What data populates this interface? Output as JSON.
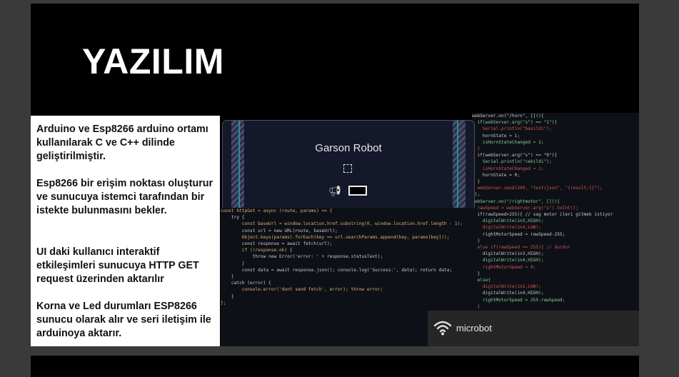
{
  "slide": {
    "title": "YAZILIM",
    "paragraphs": [
      "Arduino ve Esp8266 arduino ortamı kullanılarak C ve C++ dilinde geliştirilmiştir.",
      "Esp8266 bir erişim noktası oluşturur ve sunucuya istemci tarafından bir istekte bulunmasını bekler.",
      "UI daki kullanıcı interaktif etkileşimleri sunucuya HTTP GET request üzerinden aktarılır",
      "Korna ve Led durumları ESP8266 sunucu olarak alır ve seri iletişim ile arduinoya aktarır."
    ]
  },
  "robot_ui": {
    "title": "Garson Robot",
    "icons": [
      "fullscreen-icon",
      "horn-icon",
      "led-toggle"
    ]
  },
  "code_js": [
    "const httpGet = async (route, params) => {",
    "    try {",
    "        const baseUrl = window.location.href.substring(0, window.location.href.length - 1);",
    "        const url = new URL(route, baseUrl);",
    "        Object.keys(params).forEach(key => url.searchParams.append(key, params[key]));",
    "        const response = await fetch(url);",
    "        if (!response.ok) {",
    "            throw new Error('error: ' + response.statusText);",
    "        }",
    "        const data = await response.json(); console.log('Success:', data); return data;",
    "    }",
    "    catch (error) {",
    "        console.error('dont send fetch', error); throw error;",
    "    }",
    "};"
  ],
  "code_cpp": [
    "webServer.on(\"/horn\", [](){",
    "  if(webServer.arg(\"s\") == \"1\"){",
    "    Serial.println(\"basildi\");",
    "    hornState = 1;",
    "    isHornStateChanged = 1;",
    "  }",
    "  if(webServer.arg(\"s\") == \"0\"){",
    "    Serial.println(\"cekildi\");",
    "    isHornStateChanged = 1;",
    "    hornState = 0;",
    "  }",
    "  webServer.send(200, \"text/json\", \"{result:1}\");",
    "});",
    "webServer.on(\"/rightmotor\", [](){",
    "  rawSpeed = webServer.arg(\"s\").toInt();",
    "  if(rawSpeed>255){ // sag motor ileri gitmek istiyor",
    "    digitalWrite(in3,HIGH);",
    "    digitalWrite(in4,LOW);",
    "    rightMotorSpeed = rawSpeed-255;",
    "  }",
    "  else if(rawSpeed == 255){ // durdur",
    "    digitalWrite(in3,HIGH);",
    "    digitalWrite(in4,HIGH);",
    "    rightMotorSpeed = 0;",
    "  }",
    "  else{",
    "    digitalWrite(in3,LOW);",
    "    digitalWrite(in4,HIGH);",
    "    rightMotorSpeed = 255-rawSpeed;",
    "  }"
  ],
  "badge": {
    "label": "microbot",
    "icon": "wifi-icon"
  },
  "colors": {
    "slide_bg": "#000000",
    "panel_bg": "#ffffff",
    "robot_bg": "#14182a",
    "code_bg": "#0d1117"
  }
}
